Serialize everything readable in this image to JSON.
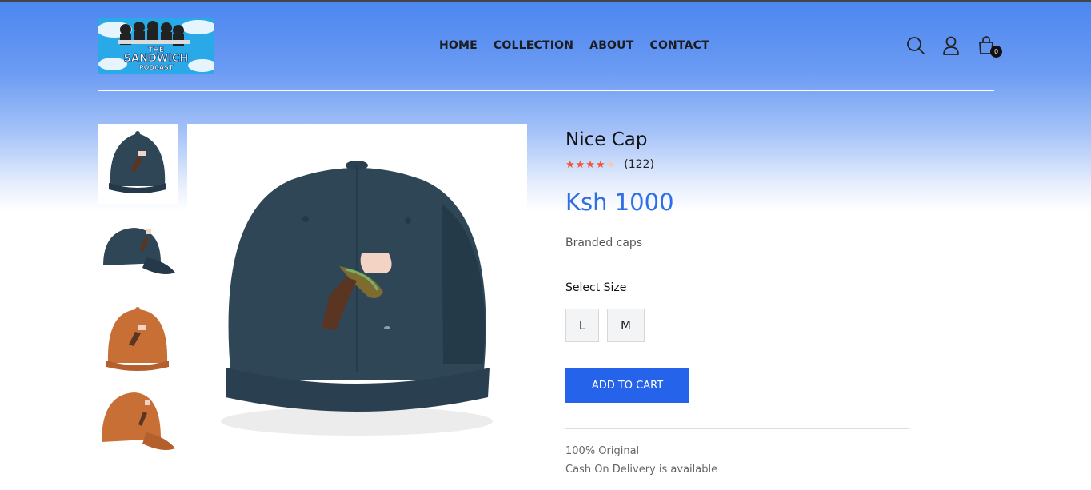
{
  "header": {
    "logo_text": "THE SANDWICH PODCAST",
    "nav": [
      "HOME",
      "COLLECTION",
      "ABOUT",
      "CONTACT"
    ],
    "cart_count": "0"
  },
  "product": {
    "title": "Nice Cap",
    "rating_stars": 4,
    "rating_count": "(122)",
    "price": "Ksh 1000",
    "description": "Branded caps",
    "size_label": "Select Size",
    "sizes": [
      "L",
      "M"
    ],
    "add_to_cart": "ADD TO CART",
    "notes": [
      "100% Original",
      "Cash On Delivery is available"
    ]
  },
  "colors": {
    "accent": "#2563eb",
    "price": "#2f6fe6",
    "cap_navy": "#2e4656",
    "cap_orange": "#c86f36",
    "star": "#f0573c"
  }
}
